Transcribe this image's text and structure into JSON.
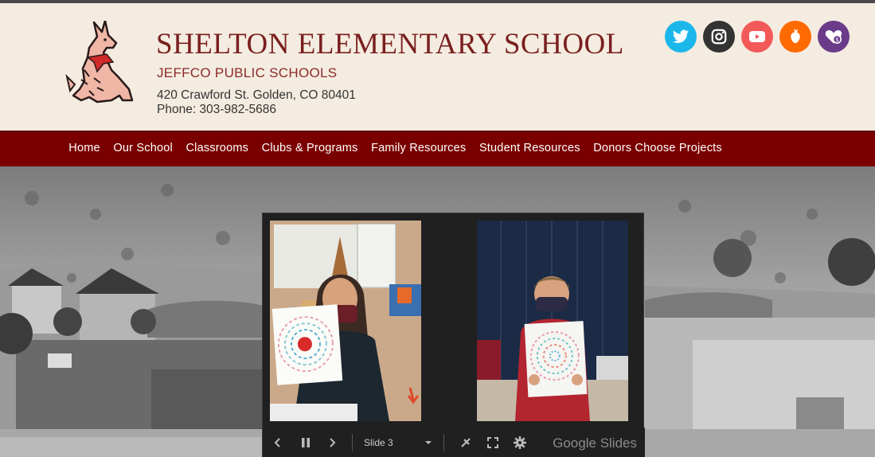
{
  "school": {
    "name": "SHELTON ELEMENTARY SCHOOL",
    "district": "JEFFCO PUBLIC SCHOOLS",
    "address": "420 Crawford St. Golden, CO 80401",
    "phone": "Phone: 303-982-5686"
  },
  "social": [
    {
      "name": "twitter-icon",
      "color": "#1da1f2"
    },
    {
      "name": "instagram-icon",
      "color": "#333333"
    },
    {
      "name": "youtube-icon",
      "color": "#ff5a5a"
    },
    {
      "name": "food-icon",
      "color": "#ff6a00"
    },
    {
      "name": "donate-icon",
      "color": "#6b3b8a"
    }
  ],
  "nav": {
    "items": [
      "Home",
      "Our School",
      "Classrooms",
      "Clubs & Programs",
      "Family Resources",
      "Student Resources",
      "Donors Choose Projects"
    ]
  },
  "slideshow": {
    "slide_label": "Slide 3",
    "brand_google": "Google",
    "brand_slides": "Slides"
  }
}
